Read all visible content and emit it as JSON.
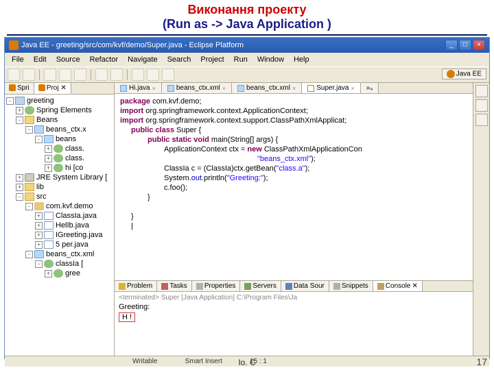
{
  "slide": {
    "title_uk": "Виконання проекту",
    "title_en": "(Run as  ->  Java Application  )",
    "page": "17",
    "footer": "Io. C"
  },
  "window": {
    "title": "Java EE - greeting/src/com/kvf/demo/Super.java - Eclipse Platform",
    "buttons": {
      "min": "_",
      "max": "□",
      "close": "×"
    }
  },
  "menu": [
    "File",
    "Edit",
    "Source",
    "Refactor",
    "Navigate",
    "Search",
    "Project",
    "Run",
    "Window",
    "Help"
  ],
  "perspective": "Java EE",
  "project_tabs": {
    "t1": "Spri",
    "t2": "Proj"
  },
  "tree": {
    "root": "greeting",
    "spring": "Spring Elements",
    "beans_parent": "Beans",
    "beans_file": "beans_ctx.x",
    "beans_node": "beans",
    "cls_a": "class.",
    "cls_b": "class.",
    "cls_hi": "hi [co",
    "jre": "JRE System Library [",
    "lib": "lib",
    "src": "src",
    "pkg": "com.kvf.demo",
    "f1": "ClassIa.java",
    "f2": "HelIb.java",
    "f3": "IGreeting.java",
    "f4": "5 per.java",
    "xml": "beans_ctx.xml",
    "cls_node": "classIa [",
    "green": "gree"
  },
  "editor_tabs": {
    "t1": "Hi.java",
    "t2": "beans_ctx.xml",
    "t3": "beans_ctx.xml",
    "t4": "Super.java"
  },
  "code": {
    "l1a": "package",
    "l1b": " com.kvf.demo;",
    "l2a": "import",
    "l2b": " org.springframework.context.ApplicationContext;",
    "l3a": "import",
    "l3b": " org.springframework.context.support.ClassPathXmlApplicat;",
    "l4a": "public class",
    "l4b": " Super {",
    "l5a": "public static void",
    "l5b": " main(String[] args) {",
    "l6a": "ApplicationContext ctx = ",
    "l6b": "new",
    "l6c": " ClassPathXmlApplicationCon",
    "l7": "\"beans_ctx.xml\"",
    "l7b": ");",
    "l8a": "ClassIa c = (ClassIa)ctx.getBean(",
    "l8b": "\"class.a\"",
    "l8c": ");",
    "l9a": "System.",
    "l9b": "out",
    "l9c": ".println(",
    "l9d": "\"Greeting:\"",
    "l9e": ");",
    "l10": "c.foo();",
    "l11": "}",
    "l12": "}"
  },
  "bottom_tabs": {
    "problems": "Problem",
    "tasks": "Tasks",
    "properties": "Properties",
    "servers": "Servers",
    "datasource": "Data Sour",
    "snippets": "Snippets",
    "console": "Console"
  },
  "console": {
    "terminated": "<terminated> Super [Java Application] C:\\Program Files\\Ja",
    "line1": "Greeting:",
    "line2": "H !"
  },
  "status": {
    "writable": "Writable",
    "insert": "Smart Insert",
    "pos": "15 : 1"
  }
}
